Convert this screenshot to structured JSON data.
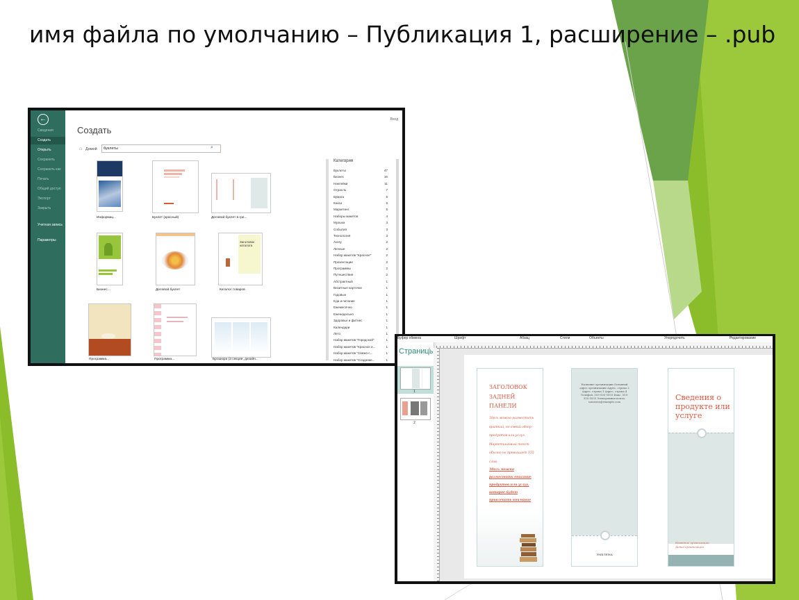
{
  "slide": {
    "title": "имя файла по умолчанию – Публикация 1, расширение  – .pub"
  },
  "colors": {
    "accent_green": "#8bbd2a",
    "backstage_green": "#2f6e5e",
    "brochure_red": "#d9573f",
    "brochure_teal": "#dde8e6"
  },
  "publisher_backstage": {
    "top_right_text": "Вход",
    "menu": [
      {
        "label": "Сведения",
        "state": "disabled"
      },
      {
        "label": "Создать",
        "state": "active"
      },
      {
        "label": "Открыть",
        "state": "normal"
      },
      {
        "label": "Сохранить",
        "state": "disabled"
      },
      {
        "label": "Сохранить как",
        "state": "disabled"
      },
      {
        "label": "Печать",
        "state": "disabled"
      },
      {
        "label": "Общий доступ",
        "state": "disabled"
      },
      {
        "label": "Экспорт",
        "state": "disabled"
      },
      {
        "label": "Закрыть",
        "state": "disabled"
      },
      {
        "label": "Учетная запись",
        "state": "normal"
      },
      {
        "label": "Параметры",
        "state": "normal"
      }
    ],
    "heading": "Создать",
    "home_label": "Домой",
    "search": {
      "value": "буклеты"
    },
    "templates": [
      {
        "label": "Информац..."
      },
      {
        "label": "Буклет (красный)"
      },
      {
        "label": "Деловой буклет в гре..."
      },
      {
        "label": "Бизнес..."
      },
      {
        "label": "Деловой буклет"
      },
      {
        "label": "Каталог товаров",
        "thumb_text": "Заголовок каталога"
      },
      {
        "label": "Программа..."
      },
      {
        "label": "Программа..."
      },
      {
        "label": "Брошюра (3 секции, дизайн..."
      }
    ],
    "category_title": "Категория",
    "categories": [
      {
        "name": "Буклеты",
        "count": "47"
      },
      {
        "name": "Бизнес",
        "count": "16"
      },
      {
        "name": "Наклейки",
        "count": "11"
      },
      {
        "name": "Отрасль",
        "count": "7"
      },
      {
        "name": "Бумага",
        "count": "5"
      },
      {
        "name": "Книги",
        "count": "5"
      },
      {
        "name": "Маркетинг",
        "count": "5"
      },
      {
        "name": "Наборы макетов",
        "count": "4"
      },
      {
        "name": "Музыка",
        "count": "3"
      },
      {
        "name": "События",
        "count": "3"
      },
      {
        "name": "Технология",
        "count": "3"
      },
      {
        "name": "Avery",
        "count": "2"
      },
      {
        "name": "Личные",
        "count": "2"
      },
      {
        "name": "Набор макетов \"Красное\"",
        "count": "2"
      },
      {
        "name": "Презентации",
        "count": "2"
      },
      {
        "name": "Программы",
        "count": "2"
      },
      {
        "name": "Путешествия",
        "count": "2"
      },
      {
        "name": "Абстрактный",
        "count": "1"
      },
      {
        "name": "Визитные карточки",
        "count": "1"
      },
      {
        "name": "Годовые",
        "count": "1"
      },
      {
        "name": "Еда и питание",
        "count": "1"
      },
      {
        "name": "Ежемесячно",
        "count": "1"
      },
      {
        "name": "Еженедельно",
        "count": "1"
      },
      {
        "name": "Здоровье и фитнес",
        "count": "1"
      },
      {
        "name": "Календари",
        "count": "1"
      },
      {
        "name": "Лето",
        "count": "1"
      },
      {
        "name": "Набор макетов \"Городской\"",
        "count": "1"
      },
      {
        "name": "Набор макетов \"Красное и...",
        "count": "1"
      },
      {
        "name": "Набор макетов \"Свежо-с...",
        "count": "1"
      },
      {
        "name": "Набор макетов \"Создание...",
        "count": "1"
      }
    ]
  },
  "publisher_editor": {
    "ribbon_groups": [
      "Буфер обмена",
      "Шрифт",
      "Абзац",
      "Стили",
      "Объекты",
      "Упорядочить",
      "Редактирование"
    ],
    "pages_pane_title": "Страницы",
    "page_numbers": [
      "1",
      "2"
    ],
    "panel1": {
      "heading": "ЗАГОЛОВОК ЗАДНЕЙ ПАНЕЛИ",
      "body": "Здесь можно разместить краткий, но емкий обзор продуктов или услуг. Маркетинговый текст обычно не превышает 155 слов.",
      "body2": "Здесь можно разместить описание продуктов или услуг, которое будет привлекать внимание"
    },
    "panel2": {
      "text": "Название организации Основной адрес организации Адрес, строка 2 Адрес, строка 3 Адрес, строка 4 Телефон: 555-555-5555 Факс: 555-555-5555 Электронная почта: someone@example.com",
      "footer": "ЭМБЛЕМА"
    },
    "panel3": {
      "title": "Сведения о продукте или услуге",
      "subtitle_line1": "Название организации",
      "subtitle_line2": "Девиз организации"
    }
  }
}
